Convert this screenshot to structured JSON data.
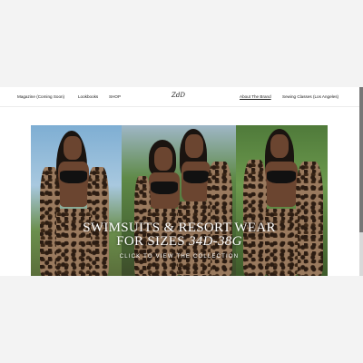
{
  "nav": {
    "left_items": [
      {
        "label": "Magazine (Coming Soon)"
      },
      {
        "label": "Lookbooks"
      },
      {
        "label": "SHOP"
      }
    ],
    "logo_text": "ZdD",
    "right_items": [
      {
        "label": "About The Brand"
      },
      {
        "label": "Sewing Classes (Los Angeles)"
      }
    ]
  },
  "hero": {
    "headline_line1": "SWIMSUITS & RESORT WEAR",
    "headline_line2_prefix": "FOR SIZES ",
    "headline_line2_sizes": "34D-38G",
    "cta": "CLICK TO VIEW THE COLLECTION"
  }
}
